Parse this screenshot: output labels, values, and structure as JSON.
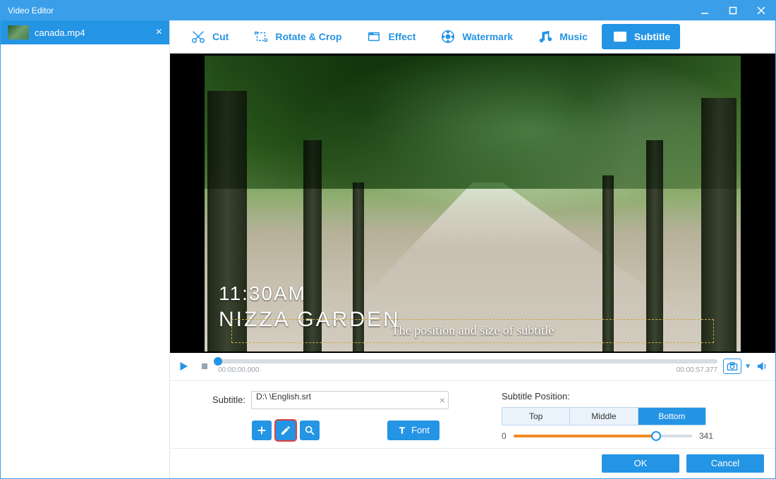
{
  "window": {
    "title": "Video Editor"
  },
  "sidebar": {
    "file": "canada.mp4"
  },
  "toolbar": {
    "cut": "Cut",
    "rotate_crop": "Rotate & Crop",
    "effect": "Effect",
    "watermark": "Watermark",
    "music": "Music",
    "subtitle": "Subtitle"
  },
  "preview": {
    "overlay_time": "11:30AM",
    "overlay_place": "NIZZA GARDEN",
    "subtitle_sample": "The position and size of subtitle"
  },
  "playbar": {
    "current": "00:00:00.000",
    "duration": "00:00:57.377"
  },
  "subtitle_panel": {
    "label": "Subtitle:",
    "path": "D:\\             \\English.srt",
    "font_btn": "Font",
    "position_label": "Subtitle Position:",
    "pos_top": "Top",
    "pos_middle": "Middle",
    "pos_bottom": "Bottom",
    "slider_min": "0",
    "slider_max": "341"
  },
  "footer": {
    "ok": "OK",
    "cancel": "Cancel"
  }
}
